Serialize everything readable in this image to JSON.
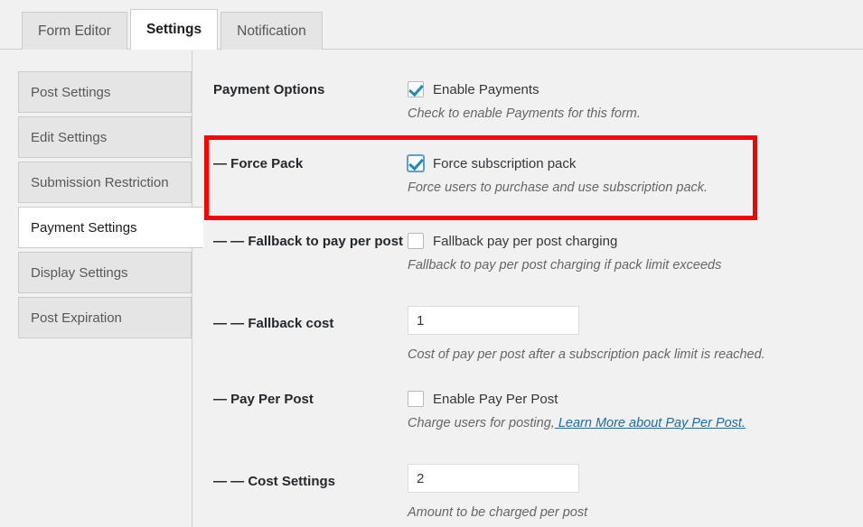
{
  "tabs": [
    {
      "label": "Form Editor",
      "active": false
    },
    {
      "label": "Settings",
      "active": true
    },
    {
      "label": "Notification",
      "active": false
    }
  ],
  "sidebar": {
    "items": [
      {
        "label": "Post Settings",
        "active": false
      },
      {
        "label": "Edit Settings",
        "active": false
      },
      {
        "label": "Submission Restriction",
        "active": false
      },
      {
        "label": "Payment Settings",
        "active": true
      },
      {
        "label": "Display Settings",
        "active": false
      },
      {
        "label": "Post Expiration",
        "active": false
      }
    ]
  },
  "settings": {
    "payment_options": {
      "label": "Payment Options",
      "checkbox_label": "Enable Payments",
      "checked": true,
      "description": "Check to enable Payments for this form."
    },
    "force_pack": {
      "label": "— Force Pack",
      "checkbox_label": "Force subscription pack",
      "checked": true,
      "description": "Force users to purchase and use subscription pack.",
      "highlighted": true,
      "highlight_color": "#fc0000"
    },
    "fallback_pay_per_post": {
      "label": "— — Fallback to pay per post",
      "checkbox_label": "Fallback pay per post charging",
      "checked": false,
      "description": "Fallback to pay per post charging if pack limit exceeds"
    },
    "fallback_cost": {
      "label": "— — Fallback cost",
      "value": "1",
      "description": "Cost of pay per post after a subscription pack limit is reached."
    },
    "pay_per_post": {
      "label": "— Pay Per Post",
      "checkbox_label": "Enable Pay Per Post",
      "checked": false,
      "description_prefix": "Charge users for posting,",
      "link_text": " Learn More about Pay Per Post."
    },
    "cost_settings": {
      "label": "— — Cost Settings",
      "value": "2",
      "description": "Amount to be charged per post"
    }
  }
}
